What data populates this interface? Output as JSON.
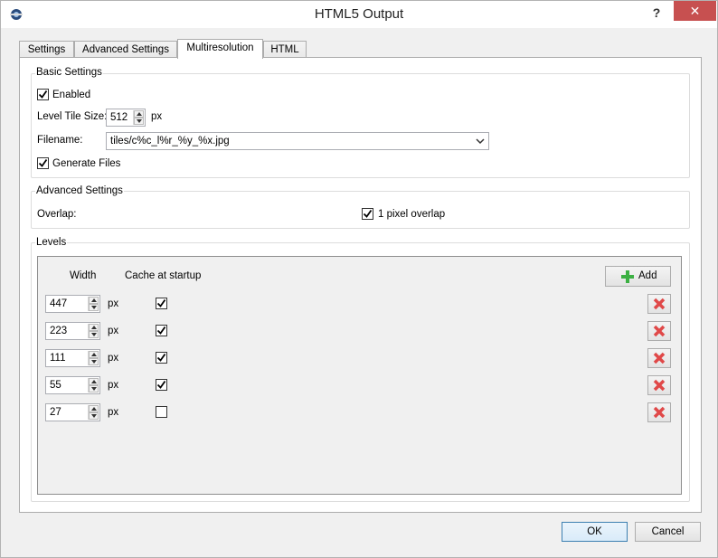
{
  "window": {
    "title": "HTML5 Output",
    "help_label": "?",
    "close_label": "✕"
  },
  "tabs": [
    {
      "label": "Settings",
      "active": false
    },
    {
      "label": "Advanced Settings",
      "active": false
    },
    {
      "label": "Multiresolution",
      "active": true
    },
    {
      "label": "HTML",
      "active": false
    }
  ],
  "basic": {
    "title": "Basic Settings",
    "enabled_label": "Enabled",
    "enabled_checked": true,
    "tile_size_label": "Level Tile Size:",
    "tile_size_value": "512",
    "tile_size_unit": "px",
    "filename_label": "Filename:",
    "filename_value": "tiles/c%c_l%r_%y_%x.jpg",
    "generate_label": "Generate Files",
    "generate_checked": true
  },
  "advanced": {
    "title": "Advanced Settings",
    "overlap_label": "Overlap:",
    "pixel_overlap_label": "1 pixel overlap",
    "pixel_overlap_checked": true
  },
  "levels": {
    "title": "Levels",
    "col_width": "Width",
    "col_cache": "Cache at startup",
    "add_label": "Add",
    "unit": "px",
    "rows": [
      {
        "width": "447",
        "cache": true
      },
      {
        "width": "223",
        "cache": true
      },
      {
        "width": "111",
        "cache": true
      },
      {
        "width": "55",
        "cache": true
      },
      {
        "width": "27",
        "cache": false
      }
    ]
  },
  "footer": {
    "ok_label": "OK",
    "cancel_label": "Cancel"
  },
  "colors": {
    "accent": "#3c7fb1",
    "delete_red": "#e04848",
    "add_green": "#3cb043",
    "close_red": "#c75050"
  },
  "icons": [
    "app-icon",
    "help-icon",
    "close-icon",
    "check-icon",
    "dropdown-arrow-icon",
    "add-plus-icon",
    "delete-x-icon"
  ]
}
